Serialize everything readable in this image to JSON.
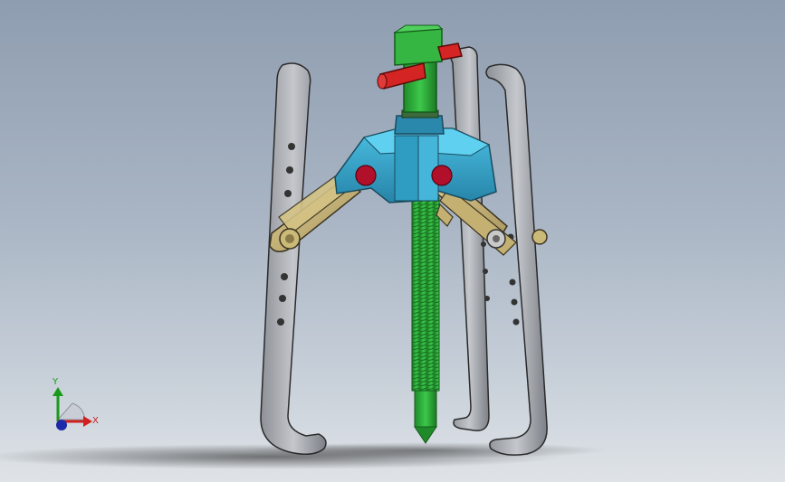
{
  "viewport": {
    "triad": {
      "x_label": "X",
      "y_label": "Y",
      "x_color": "#d02020",
      "y_color": "#1a9a1a",
      "z_color": "#1a2aa8"
    }
  },
  "model": {
    "colors": {
      "screw": "#2fae3b",
      "screw_head": "#2f9f3a",
      "handle": "#d42424",
      "body": "#3aa5c8",
      "links": "#c8b57a",
      "legs": "#a9acb1",
      "rivets": "#b0102a"
    }
  }
}
